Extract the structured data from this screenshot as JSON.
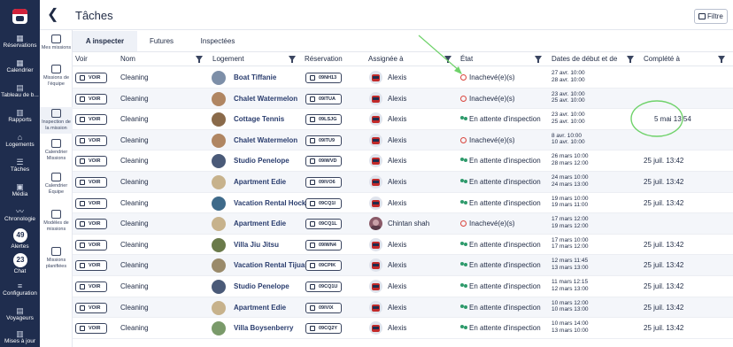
{
  "page": {
    "title": "Tâches",
    "filter_label": "Filtre"
  },
  "nav": [
    {
      "icon": "calendar-icon",
      "label": "Réservations"
    },
    {
      "icon": "calendar-icon",
      "label": "Calendrier"
    },
    {
      "icon": "dashboard-icon",
      "label": "Tableau de b..."
    },
    {
      "icon": "chart-icon",
      "label": "Rapports"
    },
    {
      "icon": "home-icon",
      "label": "Logements"
    },
    {
      "icon": "tasks-icon",
      "label": "Tâches"
    },
    {
      "icon": "media-icon",
      "label": "Média"
    },
    {
      "icon": "timeline-icon",
      "label": "Chronologie"
    },
    {
      "badge": "49",
      "label": "Alertes"
    },
    {
      "badge": "23",
      "label": "Chat"
    },
    {
      "icon": "settings-icon",
      "label": "Configuration"
    },
    {
      "icon": "travellers-icon",
      "label": "Voyageurs"
    },
    {
      "icon": "update-icon",
      "label": "Mises à jour"
    }
  ],
  "subnav": [
    {
      "label": "Mes missions"
    },
    {
      "label": "Missions de l'équipe"
    },
    {
      "label": "Inspection de la mission"
    },
    {
      "label": "Calendrier Missions"
    },
    {
      "label": "Calendrier Équipe"
    },
    {
      "label": "Modèles de missions"
    },
    {
      "label": "Missions planifiées"
    }
  ],
  "tabs": [
    "A inspecter",
    "Futures",
    "Inspectées"
  ],
  "columns": [
    "Voir",
    "Nom",
    "Logement",
    "Réservation",
    "Assignée à",
    "État",
    "Dates de début et de",
    "Complété à"
  ],
  "voir_label": "VOIR",
  "rows": [
    {
      "nom": "Cleaning",
      "logement": "Boat Tiffanie",
      "resa": "09NH13",
      "assignee": "Alexis",
      "etat": "Inachevé(e)(s)",
      "status": "red",
      "start": "27 avr. 10:00",
      "end": "28 avr. 10:00",
      "complete": ""
    },
    {
      "nom": "Cleaning",
      "logement": "Chalet Watermelon",
      "resa": "09ITUA",
      "assignee": "Alexis",
      "etat": "Inachevé(e)(s)",
      "status": "red",
      "start": "23 avr. 10:00",
      "end": "25 avr. 10:00",
      "complete": ""
    },
    {
      "nom": "Cleaning",
      "logement": "Cottage Tennis",
      "resa": "09LSJG",
      "assignee": "Alexis",
      "etat": "En attente d'inspection",
      "status": "green",
      "start": "23 avr. 10:00",
      "end": "25 avr. 10:00",
      "complete": "5 mai 13:54"
    },
    {
      "nom": "Cleaning",
      "logement": "Chalet Watermelon",
      "resa": "09ITU9",
      "assignee": "Alexis",
      "etat": "Inachevé(e)(s)",
      "status": "red",
      "start": "8 avr. 10:00",
      "end": "10 avr. 10:00",
      "complete": ""
    },
    {
      "nom": "Cleaning",
      "logement": "Studio Penelope",
      "resa": "09IWVD",
      "assignee": "Alexis",
      "etat": "En attente d'inspection",
      "status": "green",
      "start": "26 mars 10:00",
      "end": "28 mars 12:00",
      "complete": "25 juil. 13:42"
    },
    {
      "nom": "Cleaning",
      "logement": "Apartment Edie",
      "resa": "09IVO6",
      "assignee": "Alexis",
      "etat": "En attente d'inspection",
      "status": "green",
      "start": "24 mars 10:00",
      "end": "24 mars 13:00",
      "complete": "25 juil. 13:42"
    },
    {
      "nom": "Cleaning",
      "logement": "Vacation Rental Hocke",
      "resa": "09CQ1I",
      "assignee": "Alexis",
      "etat": "En attente d'inspection",
      "status": "green",
      "start": "19 mars 10:00",
      "end": "19 mars 11:00",
      "complete": "25 juil. 13:42"
    },
    {
      "nom": "Cleaning",
      "logement": "Apartment Edie",
      "resa": "09CQ1L",
      "assignee": "Chintan shah",
      "etat": "Inachevé(e)(s)",
      "status": "red",
      "start": "17 mars 12:00",
      "end": "19 mars 12:00",
      "complete": "",
      "photo": true
    },
    {
      "nom": "Cleaning",
      "logement": "Villa Jiu Jitsu",
      "resa": "09IWN4",
      "assignee": "Alexis",
      "etat": "En attente d'inspection",
      "status": "green",
      "start": "17 mars 10:00",
      "end": "17 mars 12:00",
      "complete": "25 juil. 13:42"
    },
    {
      "nom": "Cleaning",
      "logement": "Vacation Rental Tijuan",
      "resa": "09CPIK",
      "assignee": "Alexis",
      "etat": "En attente d'inspection",
      "status": "green",
      "start": "12 mars 11:45",
      "end": "13 mars 13:00",
      "complete": "25 juil. 13:42"
    },
    {
      "nom": "Cleaning",
      "logement": "Studio Penelope",
      "resa": "09CQ1U",
      "assignee": "Alexis",
      "etat": "En attente d'inspection",
      "status": "green",
      "start": "11 mars 12:15",
      "end": "12 mars 13:00",
      "complete": "25 juil. 13:42"
    },
    {
      "nom": "Cleaning",
      "logement": "Apartment Edie",
      "resa": "09IVIX",
      "assignee": "Alexis",
      "etat": "En attente d'inspection",
      "status": "green",
      "start": "10 mars 12:00",
      "end": "10 mars 13:00",
      "complete": "25 juil. 13:42"
    },
    {
      "nom": "Cleaning",
      "logement": "Villa Boysenberry",
      "resa": "09CQ2Y",
      "assignee": "Alexis",
      "etat": "En attente d'inspection",
      "status": "green",
      "start": "10 mars 14:00",
      "end": "13 mars 10:00",
      "complete": "25 juil. 13:42"
    }
  ],
  "colors": {
    "nav_bg": "#1f2d4e",
    "status_red": "#d9443c",
    "status_green": "#2e9a6b",
    "annotation_green": "#6fd26a"
  }
}
